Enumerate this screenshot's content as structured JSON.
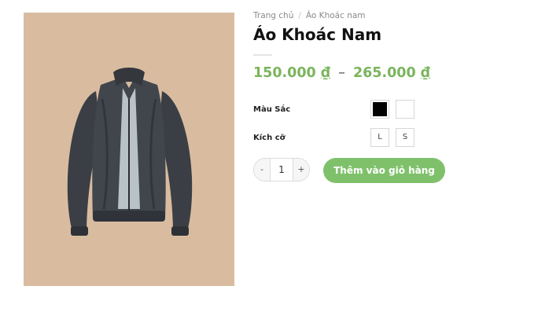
{
  "breadcrumb": {
    "home": "Trang chủ",
    "separator": "/",
    "category": "Áo Khoác nam"
  },
  "product": {
    "title": "Áo Khoác Nam",
    "price_min": "150.000",
    "price_max": "265.000",
    "currency": "₫",
    "price_separator": "–",
    "image_alt": "dark-jacket-image"
  },
  "attributes": {
    "color_label": "Màu Sắc",
    "colors": [
      "black",
      "white"
    ],
    "size_label": "Kích cỡ",
    "sizes": [
      "L",
      "S"
    ]
  },
  "cart": {
    "minus": "-",
    "quantity": "1",
    "plus": "+",
    "add_label": "Thêm vào giỏ hàng"
  },
  "colors": {
    "accent": "#7ab55c",
    "button": "#7fc16b",
    "image_bg": "#d9bca0"
  }
}
